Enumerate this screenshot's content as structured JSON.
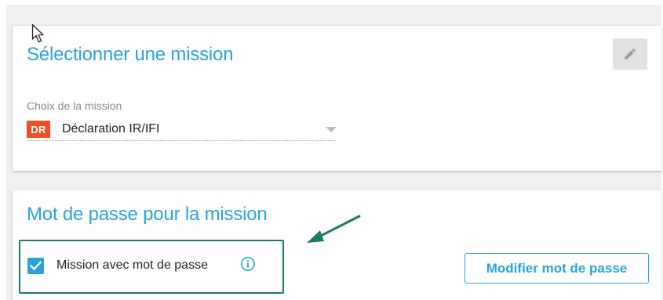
{
  "mission_card": {
    "title": "Sélectionner une mission",
    "edit_icon": "pencil-icon",
    "field_label": "Choix de la mission",
    "selected": {
      "badge": "DR",
      "badge_color": "#f14e23",
      "value": "Déclaration IR/IFI"
    },
    "dropdown_icon": "caret-down-icon"
  },
  "password_card": {
    "title": "Mot de passe pour la mission",
    "checkbox": {
      "label": "Mission avec mot de passe",
      "checked": true
    },
    "info_icon": "info-icon",
    "modify_button": "Modifier mot de passe"
  },
  "colors": {
    "accent": "#2aa3dc",
    "annotation": "#1d7a6a",
    "background": "#eef0f1"
  }
}
